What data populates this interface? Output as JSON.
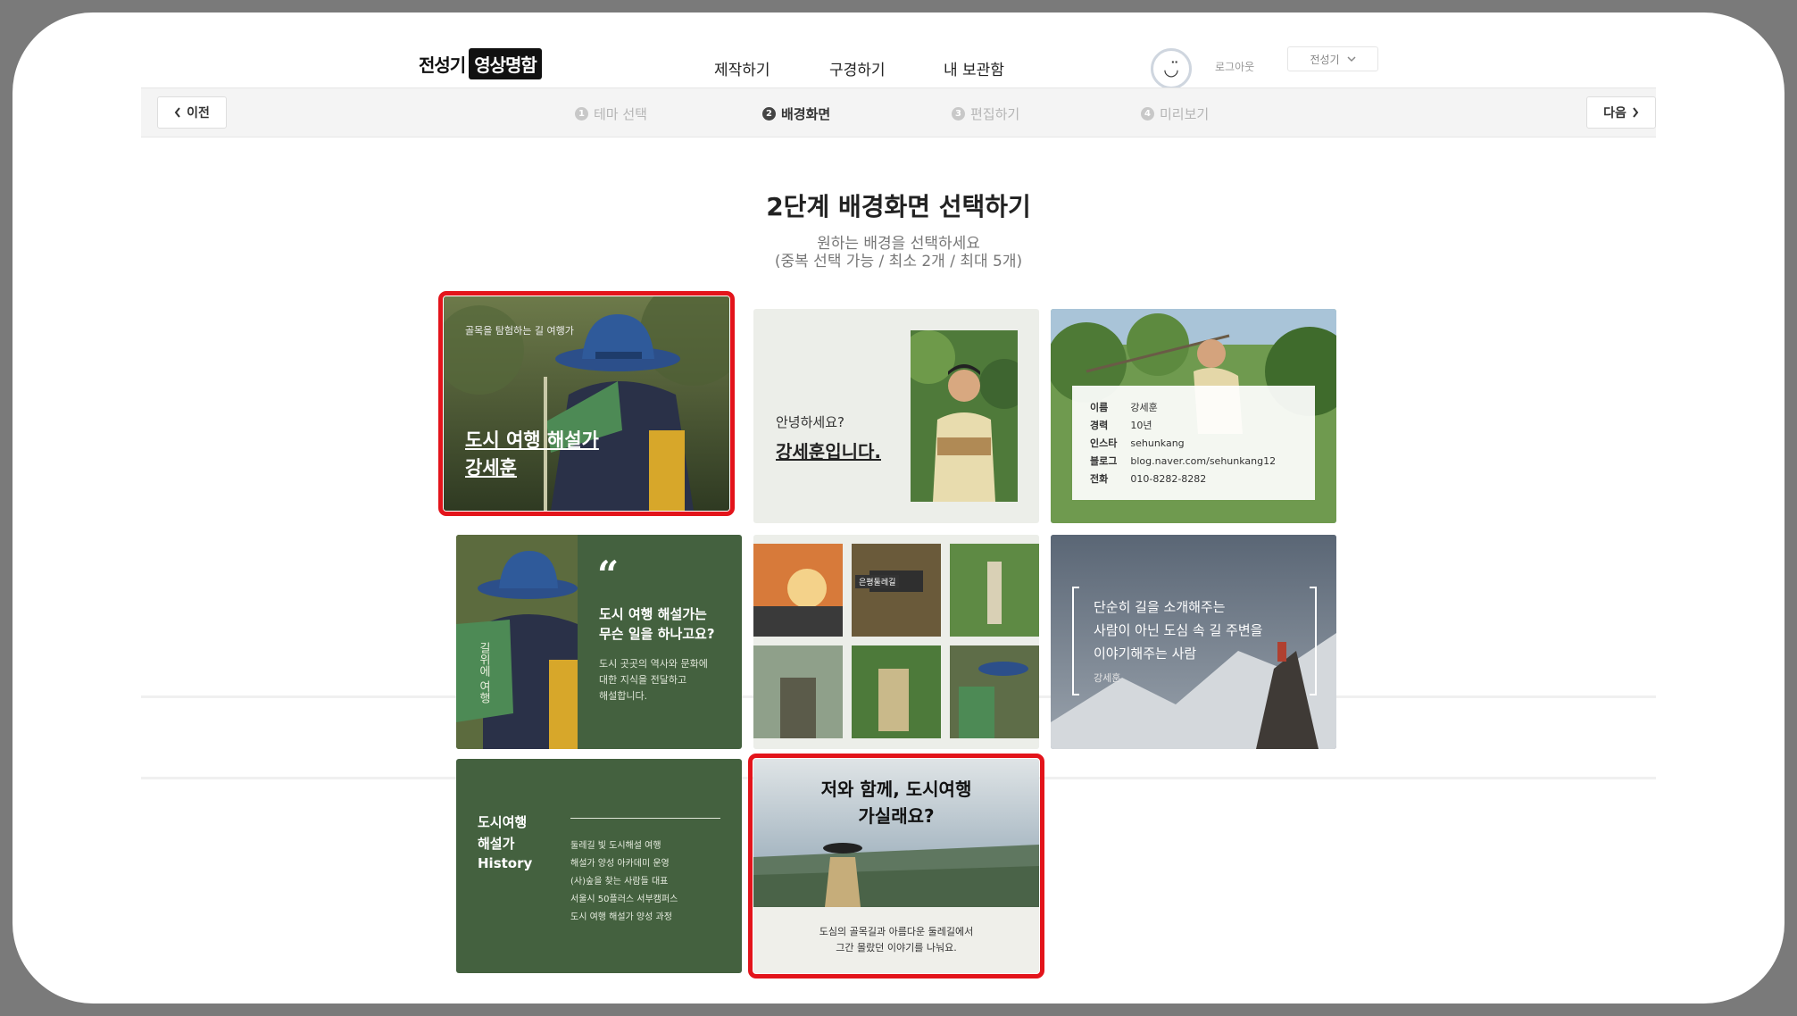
{
  "header": {
    "logo_part1": "전성기",
    "logo_part2": "영상명함",
    "nav": [
      "제작하기",
      "구경하기",
      "내 보관함"
    ],
    "avatar_glyph": "◡̈",
    "logout": "로그아웃",
    "user_name": "전성기",
    "dropdown_icon": "chevron-down-icon"
  },
  "stepbar": {
    "prev_label": "이전",
    "next_label": "다음",
    "steps": [
      {
        "num": "1",
        "label": "테마 선택",
        "active": false
      },
      {
        "num": "2",
        "label": "배경화면",
        "active": true
      },
      {
        "num": "3",
        "label": "편집하기",
        "active": false
      },
      {
        "num": "4",
        "label": "미리보기",
        "active": false
      }
    ]
  },
  "title": "2단계 배경화면 선택하기",
  "subtitle1": "원하는 배경을 선택하세요",
  "subtitle2": "(중복 선택 가능 / 최소 2개 / 최대 5개)",
  "cards": {
    "c1": {
      "small": "골목을 탐험하는 길 여행가",
      "line1": "도시 여행 해설가",
      "line2": "강세훈",
      "flag": "길위에"
    },
    "c2": {
      "greet": "안녕하세요?",
      "name": "강세훈입니다."
    },
    "c3": {
      "rows": [
        {
          "k": "이름",
          "v": "강세훈"
        },
        {
          "k": "경력",
          "v": "10년"
        },
        {
          "k": "인스타",
          "v": "sehunkang"
        },
        {
          "k": "블로그",
          "v": "blog.naver.com/sehunkang12"
        },
        {
          "k": "전화",
          "v": "010-8282-8282"
        }
      ]
    },
    "c4": {
      "quote": "“",
      "q1": "도시 여행 해설가는",
      "q2": "무슨 일을 하나고요?",
      "d1": "도시 곳곳의 역사와 문화에",
      "d2": "대한 지식을 전달하고",
      "d3": "해설합니다.",
      "flag": "길위에 여행"
    },
    "c5": {
      "sign": "은평둘레길"
    },
    "c6": {
      "l1": "단순히 길을 소개해주는",
      "l2": "사람이 아닌 도심 속 길 주변을",
      "l3": "이야기해주는 사람",
      "author": "강세훈"
    },
    "c7": {
      "t1": "도시여행",
      "t2": "해설가",
      "t3": "History",
      "items": [
        "둘레길 빛 도시해설 여행",
        "해설가 양성 아카데미 운영",
        "(사)숲을 찾는 사람들 대표",
        "서울시 50플러스 서부캠퍼스",
        "도시 여행 해설가 양성 과정"
      ]
    },
    "c8": {
      "h1": "저와 함께, 도시여행",
      "h2": "가실래요?",
      "f1": "도심의 골목길과 아름다운 둘레길에서",
      "f2": "그간 몰랐던 이야기를 나눠요."
    }
  },
  "colors": {
    "accent_selected": "#e3141b",
    "card_green": "#44613f"
  }
}
